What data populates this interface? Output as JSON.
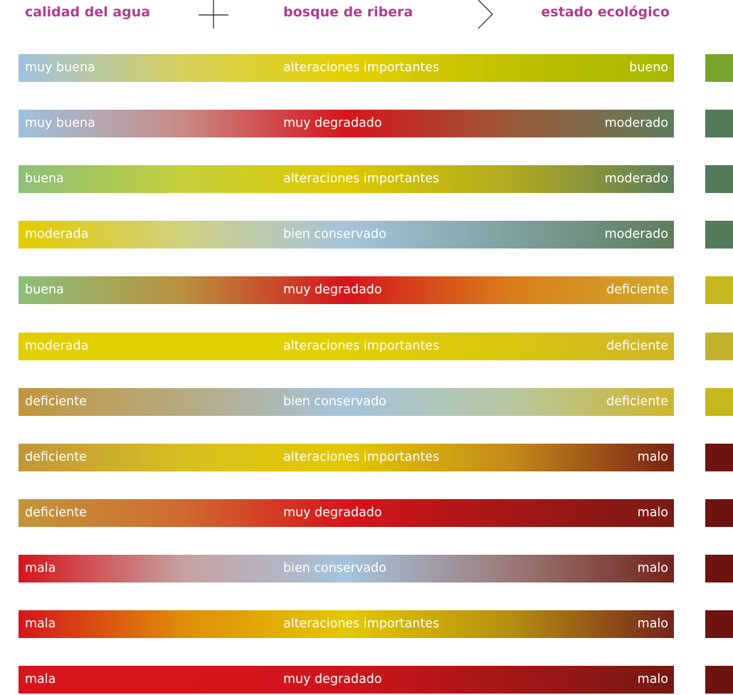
{
  "header": {
    "water_label": "calidad del agua",
    "forest_label": "bosque de ribera",
    "state_label": "estado ecológico",
    "label_color": "#b03d8f",
    "plus_icon": "plus-icon",
    "arrow_icon": "chevron-right-icon"
  },
  "rows": [
    {
      "water": "muy buena",
      "forest": "alteraciones importantes",
      "state": "bueno",
      "colors": [
        "#9fc2dc",
        "#d5cf5c",
        "#e4d000",
        "#bfc000",
        "#a8b800"
      ],
      "swatch": "#77a52b"
    },
    {
      "water": "muy buena",
      "forest": "muy degradado",
      "state": "moderado",
      "colors": [
        "#9fc2dc",
        "#c98a85",
        "#d6151c",
        "#9a5a3a",
        "#5e7e5c"
      ],
      "swatch": "#527a5b"
    },
    {
      "water": "buena",
      "forest": "alteraciones importantes",
      "state": "moderado",
      "colors": [
        "#8cc07a",
        "#c4cf3a",
        "#dcc900",
        "#b0aa20",
        "#5e7e5c"
      ],
      "swatch": "#527a5b"
    },
    {
      "water": "moderada",
      "forest": "bien conservado",
      "state": "moderado",
      "colors": [
        "#e3cc00",
        "#cfd080",
        "#a5c4dc",
        "#7fa19f",
        "#5e7e5c"
      ],
      "swatch": "#527a5b"
    },
    {
      "water": "buena",
      "forest": "muy degradado",
      "state": "deficiente",
      "colors": [
        "#8cc07a",
        "#b9903e",
        "#d6151c",
        "#d97d1a",
        "#d0aa2a"
      ],
      "swatch": "#c6b71e"
    },
    {
      "water": "moderada",
      "forest": "alteraciones importantes",
      "state": "deficiente",
      "colors": [
        "#e3cf00",
        "#e2d000",
        "#e1cf00",
        "#d8c610",
        "#cfb528"
      ],
      "swatch": "#c5b12e"
    },
    {
      "water": "deficiente",
      "forest": "bien conservado",
      "state": "deficiente",
      "colors": [
        "#c1963c",
        "#b6aa80",
        "#a5c4dc",
        "#b7c7a0",
        "#cdb62e"
      ],
      "swatch": "#c6b71e"
    },
    {
      "water": "deficiente",
      "forest": "alteraciones importantes",
      "state": "malo",
      "colors": [
        "#c1963c",
        "#d6c020",
        "#e3c800",
        "#c48a1a",
        "#7a2216"
      ],
      "swatch": "#6e1410"
    },
    {
      "water": "deficiente",
      "forest": "muy degradado",
      "state": "malo",
      "colors": [
        "#c1963c",
        "#d06a30",
        "#d6151c",
        "#a41716",
        "#7a1a14"
      ],
      "swatch": "#6e1410"
    },
    {
      "water": "mala",
      "forest": "bien conservado",
      "state": "malo",
      "colors": [
        "#d6151c",
        "#c7a0a0",
        "#a5c4dc",
        "#9c7a78",
        "#74241c"
      ],
      "swatch": "#6e1410"
    },
    {
      "water": "mala",
      "forest": "alteraciones importantes",
      "state": "malo",
      "colors": [
        "#d6151c",
        "#df8d08",
        "#e3c800",
        "#b58f10",
        "#74241c"
      ],
      "swatch": "#6e1410"
    },
    {
      "water": "mala",
      "forest": "muy degradado",
      "state": "malo",
      "colors": [
        "#d6151c",
        "#d6151c",
        "#cf151c",
        "#a41716",
        "#761814"
      ],
      "swatch": "#6e1410"
    }
  ]
}
